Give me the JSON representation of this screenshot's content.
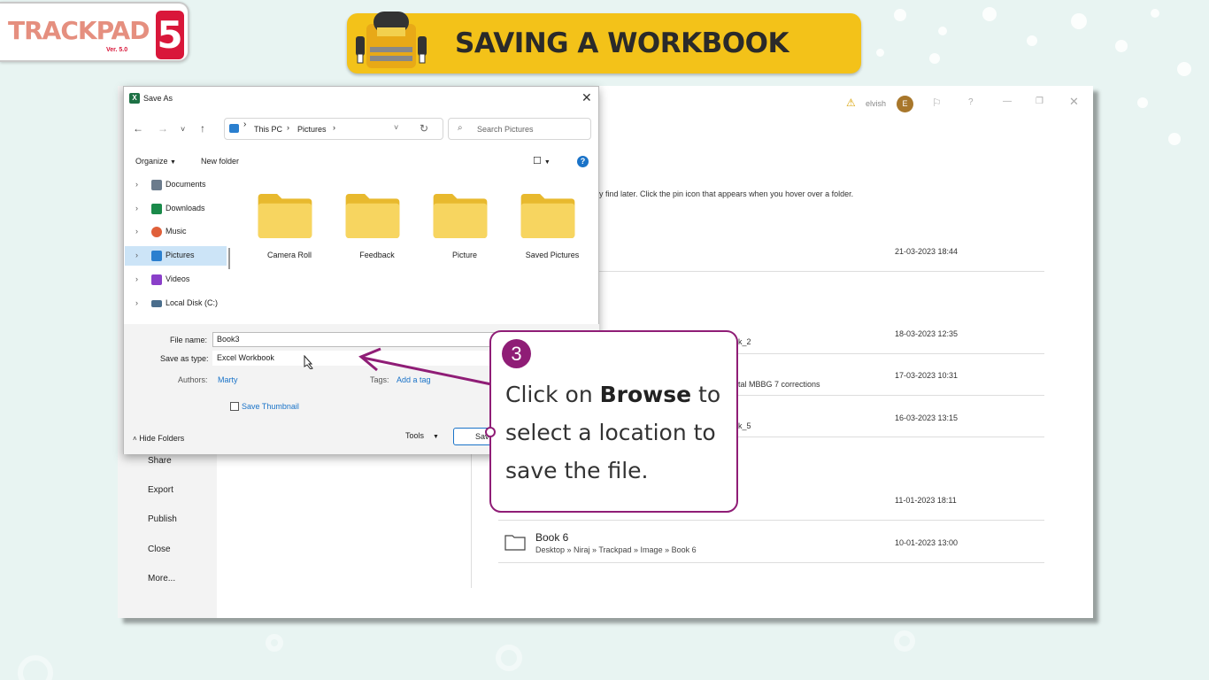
{
  "brand": {
    "logo_text": "TRACKPAD",
    "logo_number": "5",
    "version": "Ver. 5.0"
  },
  "banner": {
    "title": "SAVING A WORKBOOK"
  },
  "excel": {
    "user": {
      "name": "elvish",
      "initial": "E"
    },
    "hint": "ily find later. Click the pin icon that appears when you hover over a folder.",
    "side_items": [
      "Share",
      "Export",
      "Publish",
      "Close",
      "More..."
    ],
    "recent_rows": [
      {
        "fragment": "",
        "date": "21-03-2023 18:44"
      },
      {
        "fragment": "ok_2",
        "date": "18-03-2023 12:35"
      },
      {
        "fragment": "ital MBBG 7 corrections",
        "date": "17-03-2023 10:31"
      },
      {
        "fragment": "ok_5",
        "date": "16-03-2023 13:15"
      },
      {
        "fragment": "",
        "date": "11-01-2023 18:11"
      },
      {
        "name": "Book 6",
        "path": "Desktop » Niraj » Trackpad » Image » Book 6",
        "date": "10-01-2023 13:00"
      }
    ]
  },
  "dialog": {
    "title": "Save As",
    "breadcrumb": [
      "This PC",
      "Pictures"
    ],
    "search_placeholder": "Search Pictures",
    "organize": "Organize",
    "new_folder": "New folder",
    "nav_items": [
      {
        "label": "Documents",
        "icon": "document-icon",
        "color": "#6b7b8c"
      },
      {
        "label": "Downloads",
        "icon": "download-icon",
        "color": "#1a8a4a"
      },
      {
        "label": "Music",
        "icon": "music-icon",
        "color": "#e0603a"
      },
      {
        "label": "Pictures",
        "icon": "pictures-icon",
        "color": "#2a7fcf"
      },
      {
        "label": "Videos",
        "icon": "videos-icon",
        "color": "#8a3fc9"
      },
      {
        "label": "Local Disk (C:)",
        "icon": "disk-icon",
        "color": "#4a6d8c"
      }
    ],
    "selected_nav": "Pictures",
    "folders": [
      "Camera Roll",
      "Feedback",
      "Picture",
      "Saved Pictures"
    ],
    "file_name_label": "File name:",
    "file_name": "Book3",
    "save_type_label": "Save as type:",
    "save_type": "Excel Workbook",
    "authors_label": "Authors:",
    "authors": "Marty",
    "tags_label": "Tags:",
    "tags": "Add a tag",
    "thumbnail_label": "Save Thumbnail",
    "hide_folders": "Hide Folders",
    "tools": "Tools",
    "save_partial": "Sav"
  },
  "callout": {
    "step": "3",
    "line1_pre": "Click on ",
    "line1_bold": "Browse",
    "line1_post": " to",
    "line2": "select a location to",
    "line3": "save the file."
  },
  "colors": {
    "accent": "#8f1d76",
    "banner": "#f3c219",
    "brand_red": "#d9173a"
  }
}
